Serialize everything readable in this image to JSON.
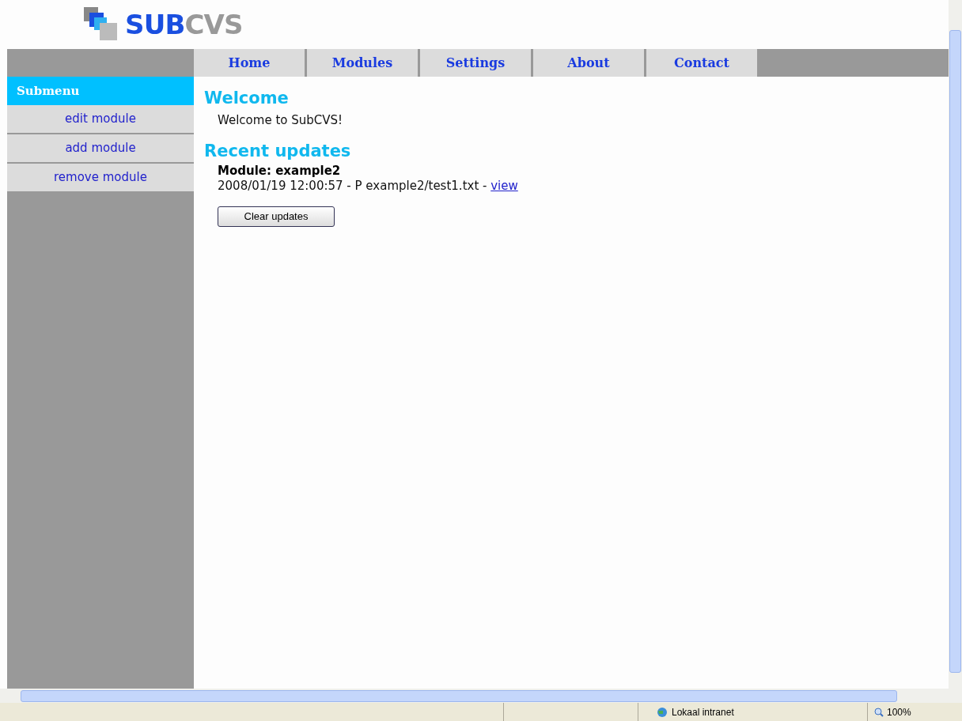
{
  "logo": {
    "text_primary": "SUB",
    "text_secondary": "CVS"
  },
  "nav": [
    {
      "label": "Home"
    },
    {
      "label": "Modules"
    },
    {
      "label": "Settings"
    },
    {
      "label": "About"
    },
    {
      "label": "Contact"
    }
  ],
  "submenu": {
    "title": "Submenu",
    "items": [
      "edit module",
      "add module",
      "remove module"
    ]
  },
  "welcome": {
    "heading": "Welcome",
    "text": "Welcome to SubCVS!"
  },
  "updates": {
    "heading": "Recent updates",
    "module": "Module: example2",
    "entry": "2008/01/19 12:00:57 - P example2/test1.txt - ",
    "link": "view",
    "button": "Clear updates"
  },
  "status_bar": {
    "zone": "Lokaal intranet",
    "zoom": "100%"
  }
}
